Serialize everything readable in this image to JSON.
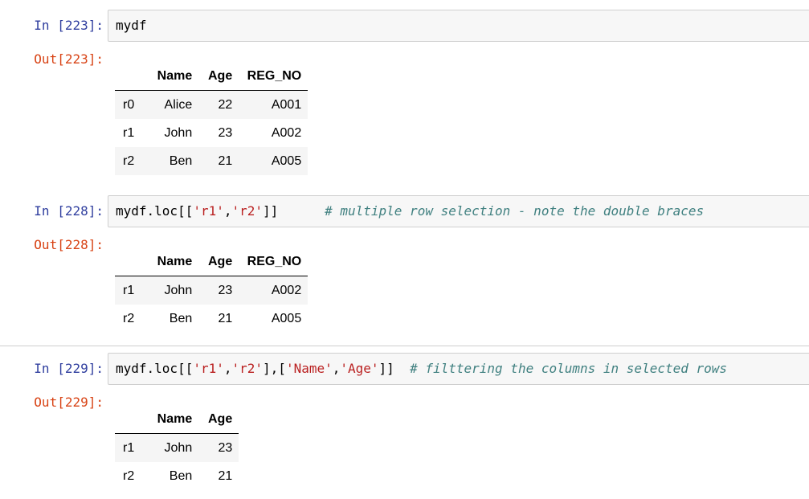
{
  "cells": [
    {
      "in_prompt": "In [223]:",
      "code_plain": "mydf",
      "out_prompt": "Out[223]:",
      "table": {
        "columns": [
          "Name",
          "Age",
          "REG_NO"
        ],
        "rows": [
          {
            "index": "r0",
            "cells": [
              "Alice",
              "22",
              "A001"
            ]
          },
          {
            "index": "r1",
            "cells": [
              "John",
              "23",
              "A002"
            ]
          },
          {
            "index": "r2",
            "cells": [
              "Ben",
              "21",
              "A005"
            ]
          }
        ]
      }
    },
    {
      "in_prompt": "In [228]:",
      "code_prefix": "mydf.loc[[",
      "code_str1": "'r1'",
      "code_sep1": ",",
      "code_str2": "'r2'",
      "code_suffix": "]]",
      "code_comment": "# multiple row selection - note the double braces",
      "out_prompt": "Out[228]:",
      "table": {
        "columns": [
          "Name",
          "Age",
          "REG_NO"
        ],
        "rows": [
          {
            "index": "r1",
            "cells": [
              "John",
              "23",
              "A002"
            ]
          },
          {
            "index": "r2",
            "cells": [
              "Ben",
              "21",
              "A005"
            ]
          }
        ]
      }
    },
    {
      "in_prompt": "In [229]:",
      "code_prefix": "mydf.loc[[",
      "code_str1": "'r1'",
      "code_sep1": ",",
      "code_str2": "'r2'",
      "code_mid": "],[",
      "code_str3": "'Name'",
      "code_sep2": ",",
      "code_str4": "'Age'",
      "code_suffix": "]]",
      "code_comment": "# filttering the columns in selected rows",
      "out_prompt": "Out[229]:",
      "table": {
        "columns": [
          "Name",
          "Age"
        ],
        "rows": [
          {
            "index": "r1",
            "cells": [
              "John",
              "23"
            ]
          },
          {
            "index": "r2",
            "cells": [
              "Ben",
              "21"
            ]
          }
        ]
      }
    }
  ]
}
